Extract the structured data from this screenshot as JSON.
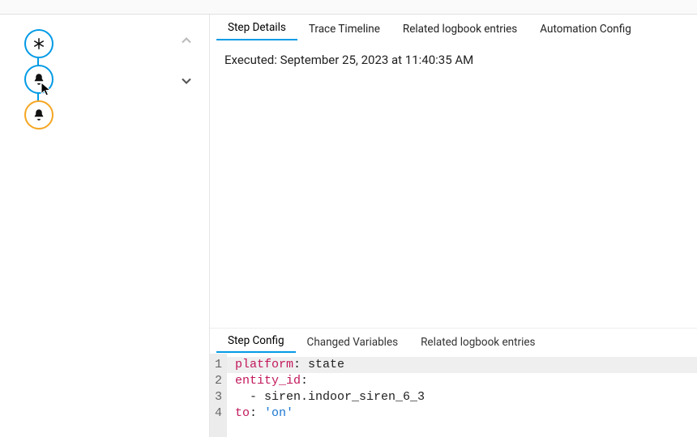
{
  "left_panel": {
    "nodes": [
      {
        "icon": "asterisk",
        "color": "blue"
      },
      {
        "icon": "bell",
        "color": "blue"
      },
      {
        "icon": "bell",
        "color": "orange"
      }
    ]
  },
  "top_tabs": {
    "items": [
      {
        "label": "Step Details",
        "active": true
      },
      {
        "label": "Trace Timeline",
        "active": false
      },
      {
        "label": "Related logbook entries",
        "active": false
      },
      {
        "label": "Automation Config",
        "active": false
      }
    ]
  },
  "detail": {
    "executed": "Executed: September 25, 2023 at 11:40:35 AM"
  },
  "bottom_tabs": {
    "items": [
      {
        "label": "Step Config",
        "active": true
      },
      {
        "label": "Changed Variables",
        "active": false
      },
      {
        "label": "Related logbook entries",
        "active": false
      }
    ]
  },
  "code": {
    "lines": [
      {
        "n": "1",
        "html": "<span class='key'>platform</span>: state"
      },
      {
        "n": "2",
        "html": "<span class='key'>entity_id</span>:"
      },
      {
        "n": "3",
        "html": "  - siren.indoor_siren_6_3"
      },
      {
        "n": "4",
        "html": "<span class='key'>to</span>: <span class='str'>'on'</span>"
      }
    ]
  }
}
